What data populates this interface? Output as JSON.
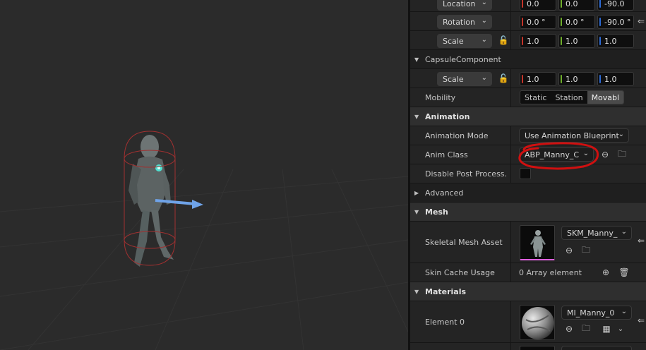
{
  "transform": {
    "location": {
      "label": "Location",
      "x": "0.0",
      "y": "0.0",
      "z": "-90.0"
    },
    "rotation": {
      "label": "Rotation",
      "x": "0.0 °",
      "y": "0.0 °",
      "z": "-90.0 °"
    },
    "scale": {
      "label": "Scale",
      "x": "1.0",
      "y": "1.0",
      "z": "1.0"
    }
  },
  "capsule": {
    "title": "CapsuleComponent",
    "scale": {
      "label": "Scale",
      "x": "1.0",
      "y": "1.0",
      "z": "1.0"
    },
    "mobility": {
      "label": "Mobility",
      "options": [
        "Static",
        "Station",
        "Movabl"
      ],
      "selected": "Movabl"
    }
  },
  "animation": {
    "title": "Animation",
    "mode_label": "Animation Mode",
    "mode_value": "Use Animation Blueprint",
    "class_label": "Anim Class",
    "class_value": "ABP_Manny_C",
    "disable_label": "Disable Post Process...",
    "advanced_label": "Advanced"
  },
  "mesh": {
    "title": "Mesh",
    "asset_label": "Skeletal Mesh Asset",
    "asset_value": "SKM_Manny_",
    "skin_label": "Skin Cache Usage",
    "skin_value": "0 Array element"
  },
  "materials": {
    "title": "Materials",
    "element0_label": "Element 0",
    "element0_value": "MI_Manny_0"
  },
  "colors": {
    "annotation": "#d01010",
    "arrow": "#6fa3e8",
    "capsule": "#a03030"
  }
}
